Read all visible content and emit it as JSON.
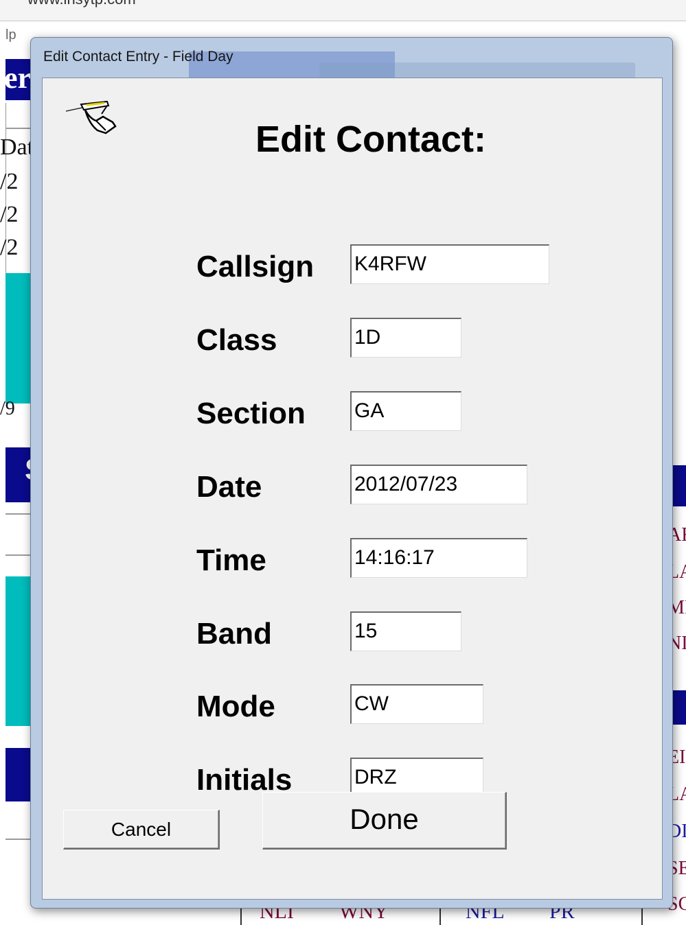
{
  "dialog": {
    "title": "Edit Contact Entry - Field Day",
    "heading": "Edit Contact:"
  },
  "form": {
    "fields": [
      {
        "label": "Callsign",
        "value": "K4RFW"
      },
      {
        "label": "Class",
        "value": "1D"
      },
      {
        "label": "Section",
        "value": "GA"
      },
      {
        "label": "Date",
        "value": "2012/07/23"
      },
      {
        "label": "Time",
        "value": "14:16:17"
      },
      {
        "label": "Band",
        "value": "15"
      },
      {
        "label": "Mode",
        "value": "CW"
      },
      {
        "label": "Initials",
        "value": "DRZ"
      }
    ]
  },
  "buttons": {
    "cancel": "Cancel",
    "done": "Done"
  },
  "icons": {
    "dialog_icon": "pen-hand-icon"
  },
  "background_app": {
    "top_partial_text": "www.insytp.com",
    "menu_partial": "lp",
    "header_partial": "er",
    "column_partial": "Dat",
    "rows_partial": [
      "/2",
      "/2",
      "/2",
      "/9"
    ],
    "section_partial": "S",
    "right_column_partial": [
      "AF",
      "LA",
      "MI",
      "NI",
      "EI",
      "LA",
      "DI",
      "SE",
      "SC"
    ],
    "bottom_partial": [
      "NLI",
      "WNY",
      "NFL",
      "PR"
    ]
  },
  "colors": {
    "titlebar": "#b9cbe2",
    "client_bg": "#f0f0f0",
    "bg_navy": "#0a0a8c",
    "bg_teal": "#00bcbc"
  }
}
